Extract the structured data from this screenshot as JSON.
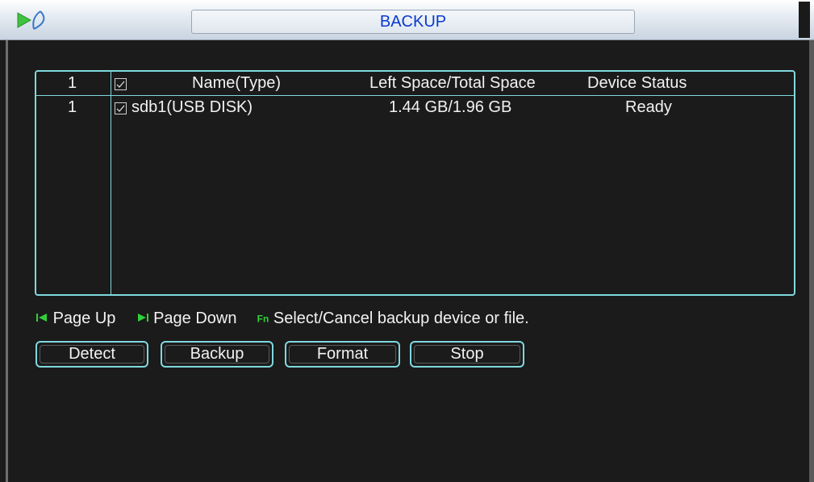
{
  "window": {
    "title": "BACKUP"
  },
  "table": {
    "header": {
      "index": "1",
      "name": "Name(Type)",
      "space": "Left Space/Total Space",
      "status": "Device Status"
    },
    "rows": [
      {
        "index": "1",
        "checked": true,
        "name": "sdb1(USB DISK)",
        "space": "1.44 GB/1.96 GB",
        "status": "Ready"
      }
    ]
  },
  "hint": {
    "page_up_label": "Page Up",
    "page_down_label": "Page Down",
    "fn_label": "Fn",
    "fn_text": "Select/Cancel backup device or file."
  },
  "buttons": {
    "detect": "Detect",
    "backup": "Backup",
    "format": "Format",
    "stop": "Stop"
  },
  "colors": {
    "accent_border": "#7fd8de",
    "title_text": "#0a3ad0",
    "hint_icon": "#31d03b"
  }
}
